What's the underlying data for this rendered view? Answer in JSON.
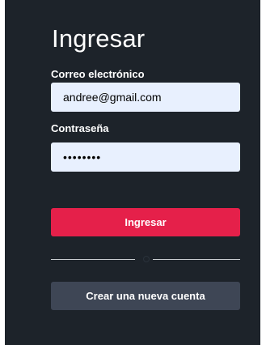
{
  "form": {
    "title": "Ingresar",
    "email_label": "Correo electrónico",
    "email_value": "andree@gmail.com",
    "password_label": "Contraseña",
    "password_value": "12345678",
    "submit_label": "Ingresar",
    "create_account_label": "Crear una nueva cuenta"
  },
  "colors": {
    "panel_background": "#1d232a",
    "input_background": "#e8f0fe",
    "primary_button": "#e5204a",
    "secondary_button": "#3e4655",
    "text": "#ffffff"
  }
}
